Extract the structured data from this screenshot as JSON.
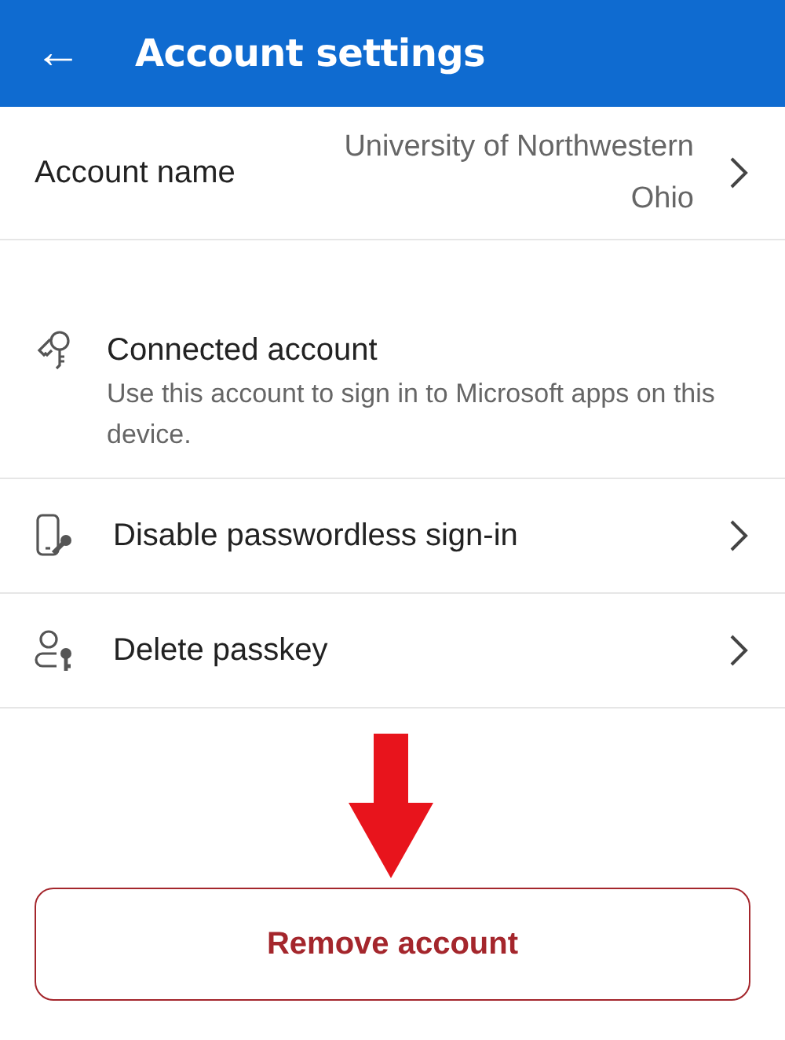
{
  "header": {
    "back_icon": "←",
    "title": "Account settings"
  },
  "account_name": {
    "label": "Account name",
    "value": "University of Northwestern Ohio"
  },
  "items": [
    {
      "kind": "info",
      "title": "Connected account",
      "description": "Use this account to sign in to Microsoft apps on this device."
    },
    {
      "kind": "link",
      "title": "Disable passwordless sign-in"
    },
    {
      "kind": "link",
      "title": "Delete passkey"
    }
  ],
  "remove_button": {
    "label": "Remove account"
  }
}
